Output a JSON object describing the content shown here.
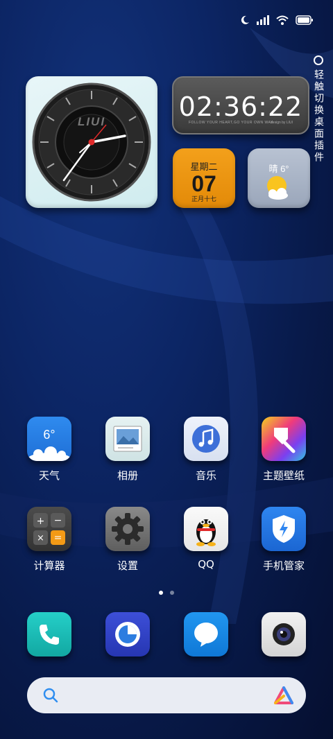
{
  "side_hint": {
    "label": "轻触切换桌面插件"
  },
  "widgets": {
    "analog_clock": {
      "brand": "LIUI"
    },
    "digital_clock": {
      "time": "02:36:22",
      "footer": "FOLLOW YOUR HEART,GO YOUR OWN WAY.",
      "signature": "design by LIUI"
    },
    "date": {
      "weekday": "星期二",
      "day": "07",
      "lunar": "正月十七"
    },
    "weather": {
      "text": "晴 6°"
    }
  },
  "apps_row1": [
    {
      "label": "天气",
      "badge": "6°"
    },
    {
      "label": "相册"
    },
    {
      "label": "音乐"
    },
    {
      "label": "主题壁纸"
    }
  ],
  "apps_row2": [
    {
      "label": "计算器"
    },
    {
      "label": "设置"
    },
    {
      "label": "QQ"
    },
    {
      "label": "手机管家"
    }
  ],
  "page_indicator": {
    "current": 1,
    "total": 2
  },
  "colors": {
    "accent_orange": "#f39a16",
    "search_bg": "#e9ecf3",
    "wallpaper": "#0c2564"
  }
}
